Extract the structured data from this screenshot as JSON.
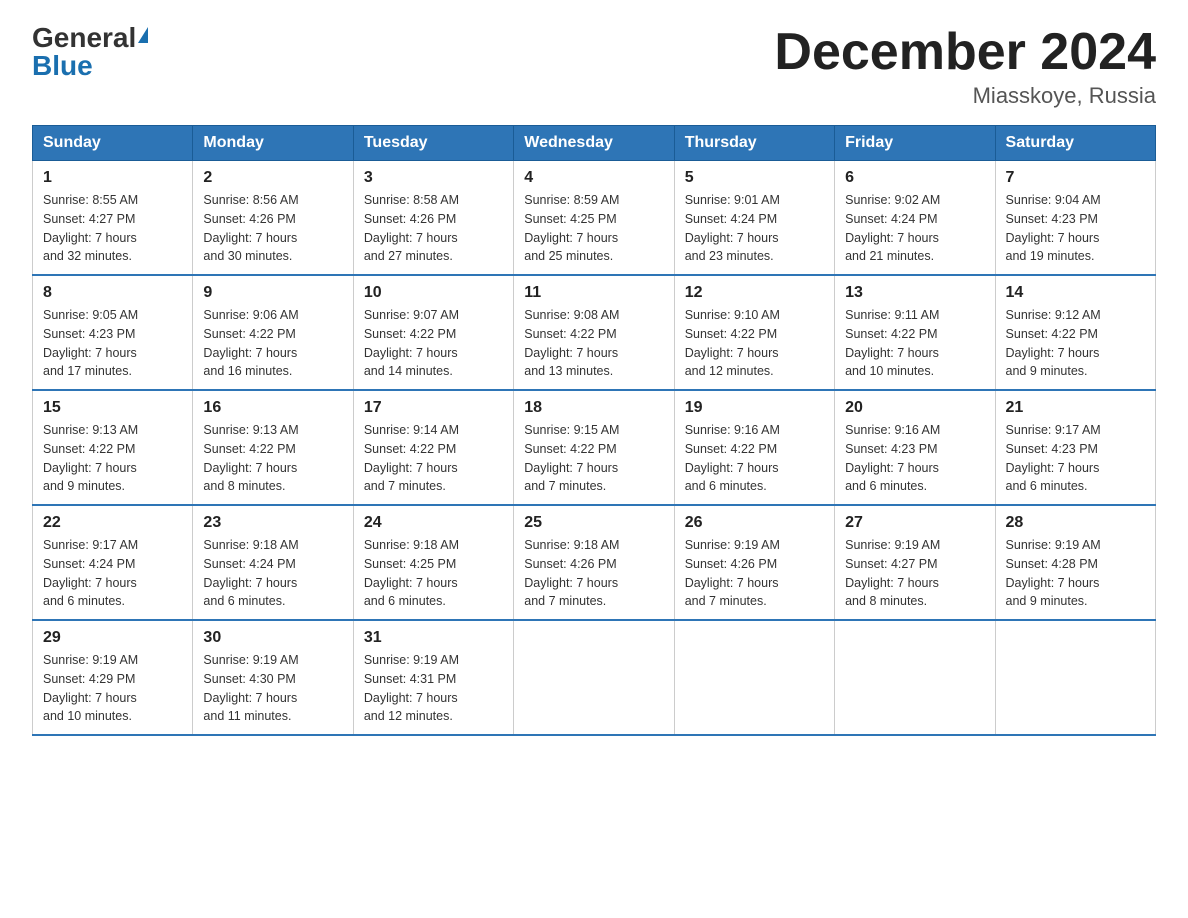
{
  "logo": {
    "general": "General",
    "blue": "Blue"
  },
  "title": "December 2024",
  "location": "Miasskoye, Russia",
  "weekdays": [
    "Sunday",
    "Monday",
    "Tuesday",
    "Wednesday",
    "Thursday",
    "Friday",
    "Saturday"
  ],
  "weeks": [
    [
      {
        "day": "1",
        "sunrise": "8:55 AM",
        "sunset": "4:27 PM",
        "daylight": "7 hours and 32 minutes."
      },
      {
        "day": "2",
        "sunrise": "8:56 AM",
        "sunset": "4:26 PM",
        "daylight": "7 hours and 30 minutes."
      },
      {
        "day": "3",
        "sunrise": "8:58 AM",
        "sunset": "4:26 PM",
        "daylight": "7 hours and 27 minutes."
      },
      {
        "day": "4",
        "sunrise": "8:59 AM",
        "sunset": "4:25 PM",
        "daylight": "7 hours and 25 minutes."
      },
      {
        "day": "5",
        "sunrise": "9:01 AM",
        "sunset": "4:24 PM",
        "daylight": "7 hours and 23 minutes."
      },
      {
        "day": "6",
        "sunrise": "9:02 AM",
        "sunset": "4:24 PM",
        "daylight": "7 hours and 21 minutes."
      },
      {
        "day": "7",
        "sunrise": "9:04 AM",
        "sunset": "4:23 PM",
        "daylight": "7 hours and 19 minutes."
      }
    ],
    [
      {
        "day": "8",
        "sunrise": "9:05 AM",
        "sunset": "4:23 PM",
        "daylight": "7 hours and 17 minutes."
      },
      {
        "day": "9",
        "sunrise": "9:06 AM",
        "sunset": "4:22 PM",
        "daylight": "7 hours and 16 minutes."
      },
      {
        "day": "10",
        "sunrise": "9:07 AM",
        "sunset": "4:22 PM",
        "daylight": "7 hours and 14 minutes."
      },
      {
        "day": "11",
        "sunrise": "9:08 AM",
        "sunset": "4:22 PM",
        "daylight": "7 hours and 13 minutes."
      },
      {
        "day": "12",
        "sunrise": "9:10 AM",
        "sunset": "4:22 PM",
        "daylight": "7 hours and 12 minutes."
      },
      {
        "day": "13",
        "sunrise": "9:11 AM",
        "sunset": "4:22 PM",
        "daylight": "7 hours and 10 minutes."
      },
      {
        "day": "14",
        "sunrise": "9:12 AM",
        "sunset": "4:22 PM",
        "daylight": "7 hours and 9 minutes."
      }
    ],
    [
      {
        "day": "15",
        "sunrise": "9:13 AM",
        "sunset": "4:22 PM",
        "daylight": "7 hours and 9 minutes."
      },
      {
        "day": "16",
        "sunrise": "9:13 AM",
        "sunset": "4:22 PM",
        "daylight": "7 hours and 8 minutes."
      },
      {
        "day": "17",
        "sunrise": "9:14 AM",
        "sunset": "4:22 PM",
        "daylight": "7 hours and 7 minutes."
      },
      {
        "day": "18",
        "sunrise": "9:15 AM",
        "sunset": "4:22 PM",
        "daylight": "7 hours and 7 minutes."
      },
      {
        "day": "19",
        "sunrise": "9:16 AM",
        "sunset": "4:22 PM",
        "daylight": "7 hours and 6 minutes."
      },
      {
        "day": "20",
        "sunrise": "9:16 AM",
        "sunset": "4:23 PM",
        "daylight": "7 hours and 6 minutes."
      },
      {
        "day": "21",
        "sunrise": "9:17 AM",
        "sunset": "4:23 PM",
        "daylight": "7 hours and 6 minutes."
      }
    ],
    [
      {
        "day": "22",
        "sunrise": "9:17 AM",
        "sunset": "4:24 PM",
        "daylight": "7 hours and 6 minutes."
      },
      {
        "day": "23",
        "sunrise": "9:18 AM",
        "sunset": "4:24 PM",
        "daylight": "7 hours and 6 minutes."
      },
      {
        "day": "24",
        "sunrise": "9:18 AM",
        "sunset": "4:25 PM",
        "daylight": "7 hours and 6 minutes."
      },
      {
        "day": "25",
        "sunrise": "9:18 AM",
        "sunset": "4:26 PM",
        "daylight": "7 hours and 7 minutes."
      },
      {
        "day": "26",
        "sunrise": "9:19 AM",
        "sunset": "4:26 PM",
        "daylight": "7 hours and 7 minutes."
      },
      {
        "day": "27",
        "sunrise": "9:19 AM",
        "sunset": "4:27 PM",
        "daylight": "7 hours and 8 minutes."
      },
      {
        "day": "28",
        "sunrise": "9:19 AM",
        "sunset": "4:28 PM",
        "daylight": "7 hours and 9 minutes."
      }
    ],
    [
      {
        "day": "29",
        "sunrise": "9:19 AM",
        "sunset": "4:29 PM",
        "daylight": "7 hours and 10 minutes."
      },
      {
        "day": "30",
        "sunrise": "9:19 AM",
        "sunset": "4:30 PM",
        "daylight": "7 hours and 11 minutes."
      },
      {
        "day": "31",
        "sunrise": "9:19 AM",
        "sunset": "4:31 PM",
        "daylight": "7 hours and 12 minutes."
      },
      null,
      null,
      null,
      null
    ]
  ],
  "labels": {
    "sunrise": "Sunrise:",
    "sunset": "Sunset:",
    "daylight": "Daylight:"
  }
}
